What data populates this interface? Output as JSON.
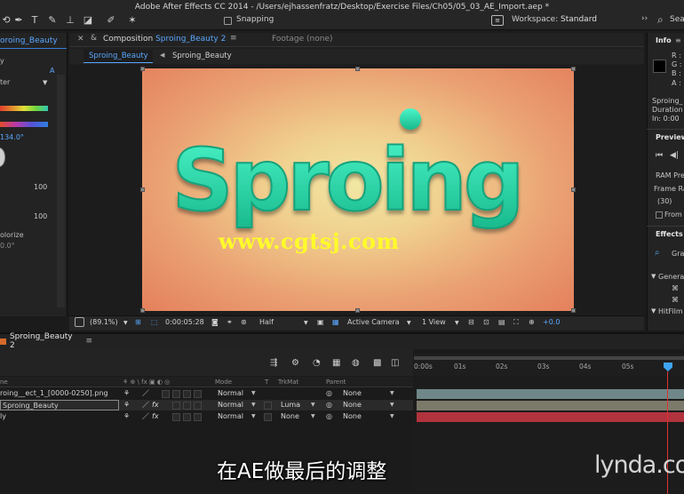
{
  "window": {
    "title": "Adobe After Effects CC 2014 - /Users/ejhassenfratz/Desktop/Exercise Files/Ch05/05_03_AE_Import.aep *"
  },
  "toolbar": {
    "snapping_label": "Snapping",
    "workspace_label": "Workspace:",
    "workspace_value": "Standard",
    "search_label": "Sea"
  },
  "effect_controls": {
    "tab_label": "oroing_Beauty",
    "row_y": "y",
    "dropdown_value": "ter",
    "a_link": "A",
    "angle_value": "134.0°",
    "value_a": "100",
    "value_b": "100",
    "colorize_label": "olorize",
    "colorize_value": "0.0°"
  },
  "composition": {
    "tab_prefix": "Composition",
    "tab_name": "Sproing_Beauty 2",
    "menu_icon": "≡",
    "footage_tab": "Footage (none)",
    "subtab_active": "Sproing_Beauty 2",
    "subtab_2": "Sproing_Beauty",
    "artwork_text": "Sproing",
    "watermark": "www.cgtsj.com"
  },
  "viewer_bar": {
    "zoom": "(89.1%)",
    "timecode": "0:00:05:28",
    "resolution": "Half",
    "camera": "Active Camera",
    "view": "1 View",
    "exposure": "+0.0"
  },
  "info_panel": {
    "title": "Info",
    "r": "R :",
    "g": "G :",
    "b": "B :",
    "a": "A :",
    "name": "Sproing_",
    "duration": "Duration",
    "in": "In: 0:00"
  },
  "preview_panel": {
    "title": "Preview",
    "ram": "RAM Pre",
    "frame_rate": "Frame Ra",
    "fps": "(30)",
    "from": "From"
  },
  "effects_panel": {
    "title": "Effects &",
    "search": "Gra",
    "category1": "Genera",
    "category2": "HitFilm"
  },
  "timeline": {
    "tab_label": "Sproing_Beauty 2",
    "headers": {
      "name": "ne",
      "mode": "Mode",
      "t": "T",
      "trkmat": "TrkMat",
      "parent": "Parent"
    },
    "layers": [
      {
        "name": "roing__ect_1_[0000-0250].png",
        "mode": "Normal",
        "trkmat": "",
        "parent": "None"
      },
      {
        "name": "Sproing_Beauty",
        "mode": "Normal",
        "trkmat": "Luma",
        "parent": "None"
      },
      {
        "name": "ly",
        "mode": "Normal",
        "trkmat": "None",
        "parent": "None"
      }
    ],
    "ruler": [
      "0:00s",
      "01s",
      "02s",
      "03s",
      "04s",
      "05s"
    ],
    "bar_colors": [
      "#6f8788",
      "#7c7a6a",
      "#b0333e"
    ]
  },
  "subtitle": "在AE做最后的调整",
  "brand": "lynda.com"
}
